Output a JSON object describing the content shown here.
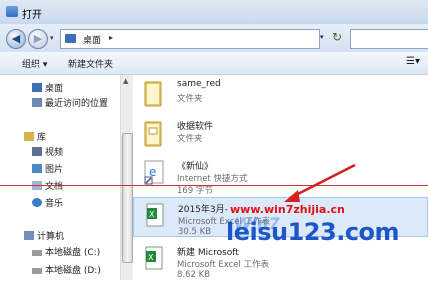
{
  "window": {
    "title": "打开"
  },
  "address": {
    "crumb": "桌面",
    "separator": "▸"
  },
  "toolbar": {
    "organize": "组织 ▾",
    "new_folder": "新建文件夹"
  },
  "sidebar": {
    "items": [
      {
        "label": "桌面",
        "icon": "desktop-icon"
      },
      {
        "label": "最近访问的位置",
        "icon": "recent-places-icon"
      },
      {
        "label": "库",
        "icon": "library-icon"
      },
      {
        "label": "视频",
        "icon": "video-icon"
      },
      {
        "label": "图片",
        "icon": "pictures-icon"
      },
      {
        "label": "文档",
        "icon": "documents-icon"
      },
      {
        "label": "音乐",
        "icon": "music-icon"
      },
      {
        "label": "计算机",
        "icon": "computer-icon"
      },
      {
        "label": "本地磁盘 (C:)",
        "icon": "disk-icon"
      },
      {
        "label": "本地磁盘 (D:)",
        "icon": "disk-icon"
      }
    ]
  },
  "files": [
    {
      "name": "same_red",
      "type": "文件夹",
      "size": "",
      "icon": "folder-icon"
    },
    {
      "name": "收据软件",
      "type": "文件夹",
      "size": "",
      "icon": "folder-icon"
    },
    {
      "name": "《新仙》",
      "type": "Internet 快捷方式",
      "size": "169 字节",
      "icon": "internet-shortcut-icon"
    },
    {
      "name": "2015年3月-",
      "type": "Microsoft Excel 工作表",
      "size": "30.5 KB",
      "icon": "excel-icon"
    },
    {
      "name": "新建 Microsoft",
      "type": "Microsoft Excel 工作表",
      "size": "8.62 KB",
      "icon": "excel-icon"
    }
  ],
  "watermark": {
    "line1": "www.win7zhijia.cn",
    "line2": "leisu123.com",
    "logo": "Win7"
  },
  "colors": {
    "selection": "#dbe9fb",
    "red_line": "#d03030",
    "watermark_blue": "#1c56c8"
  }
}
